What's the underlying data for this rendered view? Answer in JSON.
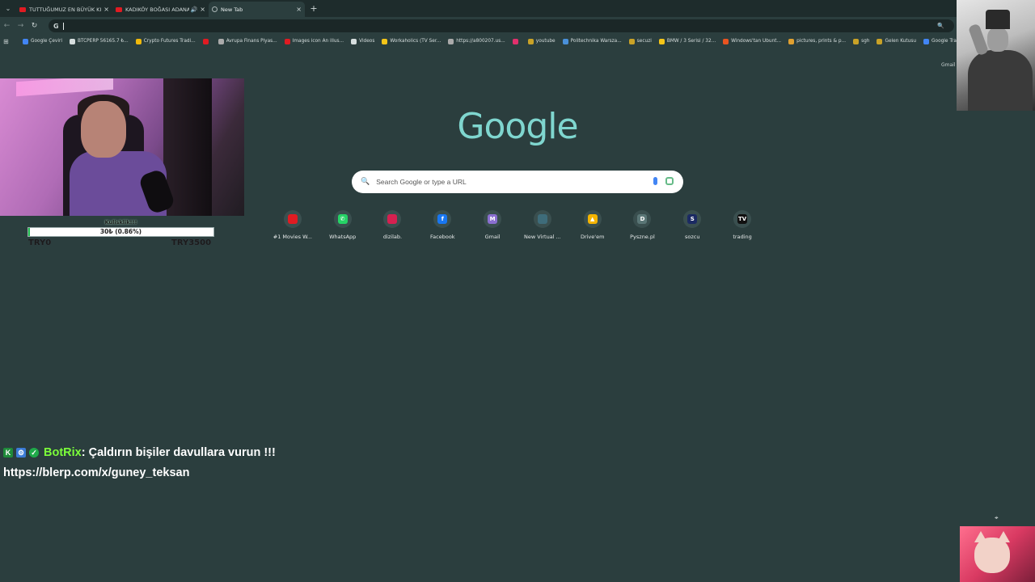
{
  "tabs": [
    {
      "label": "TUTTUĞUMUZ EN BÜYÜK KILIÇ",
      "favicon": "youtube-icon",
      "active": false
    },
    {
      "label": "KADIKÖY BOĞASI ADANA",
      "favicon": "youtube-icon",
      "active": false,
      "audio": true
    },
    {
      "label": "New Tab",
      "favicon": "globe-icon",
      "active": true
    }
  ],
  "omnibox": {
    "value": ""
  },
  "bookmarks": [
    {
      "label": "Google Çeviri",
      "color": "#4285f4"
    },
    {
      "label": "BTCPERP 56165.7 ₺...",
      "color": "#d6dede"
    },
    {
      "label": "Crypto Futures Tradi...",
      "color": "#f0b90b"
    },
    {
      "label": "",
      "color": "#e01b22"
    },
    {
      "label": "Avrupa Finans Piyas...",
      "color": "#aaaaaa"
    },
    {
      "label": "Images icon An illus...",
      "color": "#e01b22"
    },
    {
      "label": "Videos",
      "color": "#d6dede"
    },
    {
      "label": "Workaholics (TV Ser...",
      "color": "#f5c518"
    },
    {
      "label": "https://a800207.us...",
      "color": "#aaaaaa"
    },
    {
      "label": "",
      "color": "#e1306c"
    },
    {
      "label": "youtube",
      "color": "#c9a227"
    },
    {
      "label": "Politechnika Warsza...",
      "color": "#4a90d9"
    },
    {
      "label": "secuzi",
      "color": "#c9a227"
    },
    {
      "label": "BMW / 3 Serisi / 32...",
      "color": "#f5c518"
    },
    {
      "label": "Windows'tan Ubunt...",
      "color": "#e95420"
    },
    {
      "label": "pictures, prints & p...",
      "color": "#e0a030"
    },
    {
      "label": "sgh",
      "color": "#c9a227"
    },
    {
      "label": "Gelen Kutusu",
      "color": "#c9a227"
    },
    {
      "label": "Google Translate",
      "color": "#4285f4"
    }
  ],
  "gmail_top": "Gmail",
  "logo": "Google",
  "search": {
    "placeholder": "Search Google or type a URL"
  },
  "shortcuts": [
    {
      "label": "#1 Movies W...",
      "icon": "movies-icon",
      "color": "#e01b22",
      "glyph": ""
    },
    {
      "label": "WhatsApp",
      "icon": "whatsapp-icon",
      "color": "#25d366",
      "glyph": "✆"
    },
    {
      "label": "dizilab.",
      "icon": "dizilab-icon",
      "color": "#d62050",
      "glyph": ""
    },
    {
      "label": "Facebook",
      "icon": "facebook-icon",
      "color": "#1877f2",
      "glyph": "f"
    },
    {
      "label": "Gmail",
      "icon": "gmail-icon",
      "color": "#8a6fd0",
      "glyph": "M"
    },
    {
      "label": "New Virtual ...",
      "icon": "virtual-icon",
      "color": "#3e6c7a",
      "glyph": ""
    },
    {
      "label": "Drive'em",
      "icon": "drive-icon",
      "color": "#f4b400",
      "glyph": "▲"
    },
    {
      "label": "Pyszne.pl",
      "icon": "pyszne-icon",
      "color": "#5a7676",
      "glyph": "D"
    },
    {
      "label": "sozcu",
      "icon": "sozcu-icon",
      "color": "#1b2a63",
      "glyph": "S"
    },
    {
      "label": "trading",
      "icon": "tradingview-icon",
      "color": "#111111",
      "glyph": "TV"
    }
  ],
  "donation": {
    "title": "Kulisklik!!!",
    "amount_text": "30₺ (0.86%)",
    "progress": 0.0086,
    "min": "TRY0",
    "max": "TRY3500"
  },
  "chat": {
    "user": "BotRix",
    "message": " : Çaldırın bişiler davullara vurun !!!",
    "link": "https://blerp.com/x/guney_teksan"
  }
}
